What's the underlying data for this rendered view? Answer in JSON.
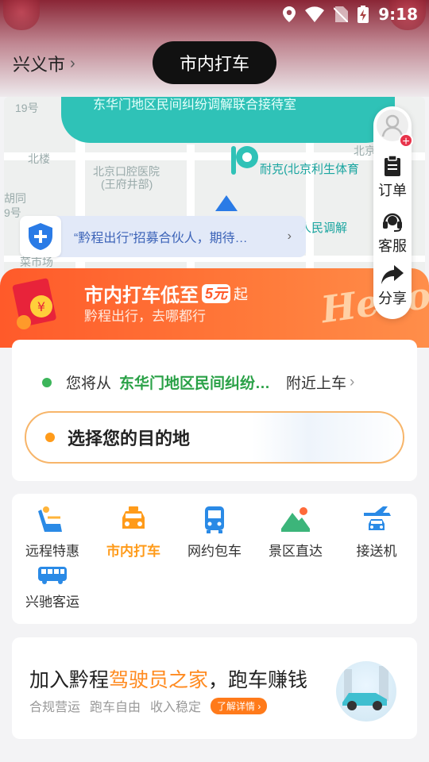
{
  "status_bar": {
    "time": "9:18",
    "icons": [
      "location-icon",
      "wifi-icon",
      "no-sim-icon",
      "battery-charging-icon"
    ]
  },
  "header": {
    "city": "兴义市",
    "title": "市内打车"
  },
  "map": {
    "labels": [
      "北楼",
      "北京口腔医院",
      "(王府井部)",
      "胡同",
      "9号",
      "菜市场",
      "19号",
      "耐克(北京利生体育",
      "人民调解",
      "北京"
    ],
    "banner_text": "东华门地区民间纠纷调解联合接待室",
    "notice_text": "“黔程出行”招募合伙人，期待…"
  },
  "side_menu": {
    "orders": "订单",
    "service": "客服",
    "share": "分享"
  },
  "promo": {
    "title": "市内打车低至",
    "price": "5元",
    "suffix": "起",
    "subtitle": "黔程出行，去哪都行",
    "deco": "Hello"
  },
  "trip": {
    "from_prefix": "您将从",
    "from_location": "东华门地区民间纠纷调解联合接待室",
    "from_suffix": "附近上车",
    "destination_placeholder": "选择您的目的地"
  },
  "services": [
    {
      "label": "远程特惠",
      "icon": "seat-icon"
    },
    {
      "label": "市内打车",
      "icon": "taxi-icon"
    },
    {
      "label": "网约包车",
      "icon": "bus-icon"
    },
    {
      "label": "景区直达",
      "icon": "scenic-icon"
    },
    {
      "label": "接送机",
      "icon": "airport-transfer-icon"
    },
    {
      "label": "兴驰客运",
      "icon": "coach-icon"
    }
  ],
  "join": {
    "title_prefix": "加入黔程",
    "title_highlight": "驾驶员之家",
    "title_suffix": "，跑车赚钱",
    "tags": [
      "合规营运",
      "跑车自由",
      "收入稳定"
    ],
    "button": "了解详情"
  },
  "colors": {
    "accent_orange": "#ff9b1a",
    "promo_orange": "#ff5a2a",
    "teal": "#2fc2b7",
    "green": "#2aa147"
  }
}
